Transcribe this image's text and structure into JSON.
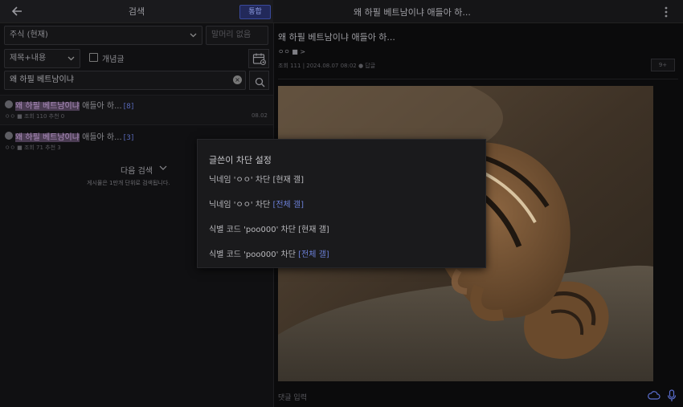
{
  "left": {
    "header": {
      "title": "검색",
      "integrated_label": "통합"
    },
    "board_select": {
      "value": "주식 (현재)"
    },
    "head_filter": {
      "placeholder": "말머리 없음"
    },
    "type_select": {
      "value": "제목+내용"
    },
    "concept_checkbox": {
      "label": "개념글",
      "checked": false
    },
    "search": {
      "value": "왜 하필 베트남이냐"
    },
    "results": [
      {
        "title_hl": "왜 하필 베트남이냐",
        "title_rest": " 애들아 하...",
        "comments": "[8]",
        "meta": "ㅇㅇ ■ 조회 110 추천 0",
        "date": "08.02"
      },
      {
        "title_hl": "왜 하필 베트남이냐",
        "title_rest": " 애들아 하...",
        "comments": "[3]",
        "meta": "ㅇㅇ ■ 조회 71 추천 3",
        "date": ""
      }
    ],
    "next_search": "다음 검색",
    "note": "게시물은 1만개 단위로 검색됩니다."
  },
  "right": {
    "header": {
      "title": "왜 하필 베트남이냐 애들아 하..."
    },
    "post": {
      "title": "왜 하필 베트남이냐 애들아 하...",
      "author": "ㅇㅇ ■ >",
      "meta": "조회 111 | 2024.08.07 08:02  ● 답글",
      "comment_count": "9+"
    },
    "comment_input": {
      "placeholder": "댓글 입력"
    }
  },
  "modal": {
    "title": "글쓴이 차단 설정",
    "items": [
      {
        "text": "닉네임 'ㅇㅇ' 차단 ",
        "scope": "[현재 갤]",
        "scope_all": false
      },
      {
        "text": "닉네임 'ㅇㅇ' 차단 ",
        "scope": "[전체 갤]",
        "scope_all": true
      },
      {
        "text": "식별 코드 'poo000' 차단 ",
        "scope": "[현재 갤]",
        "scope_all": false
      },
      {
        "text": "식별 코드 'poo000' 차단 ",
        "scope": "[전체 갤]",
        "scope_all": true
      }
    ]
  },
  "icons": [
    "back-arrow-icon",
    "chevron-down-icon",
    "calendar-icon",
    "clear-icon",
    "search-icon",
    "kebab-menu-icon",
    "cloud-icon",
    "mic-icon"
  ]
}
